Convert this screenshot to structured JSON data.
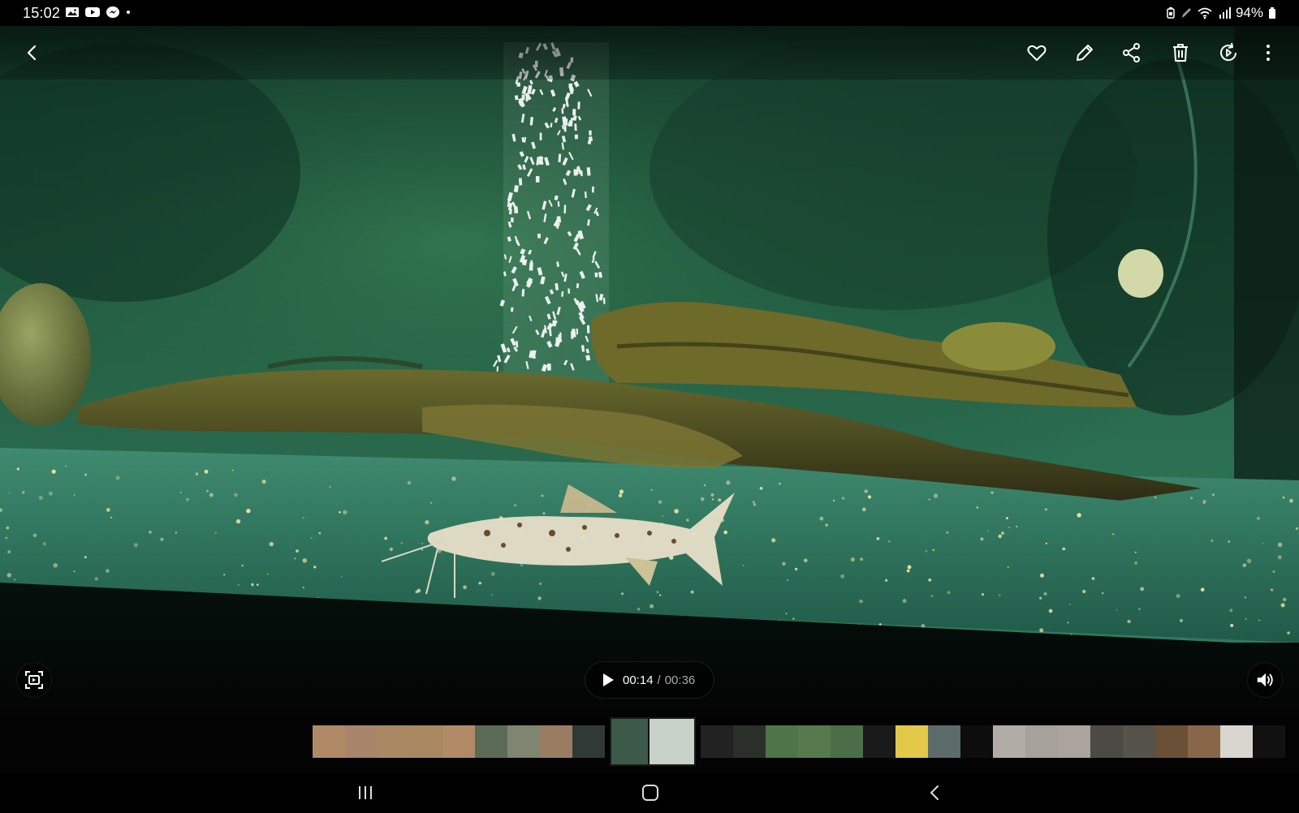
{
  "status_bar": {
    "time": "15:02",
    "left_icons": [
      "gallery-notification-icon",
      "youtube-notification-icon",
      "messenger-notification-icon",
      "more-notifications-dot-icon"
    ],
    "right_icons": [
      "battery-saver-icon",
      "pen-icon",
      "wifi-icon",
      "signal-icon"
    ],
    "battery_text": "94%"
  },
  "toolbar": {
    "back": "back-icon",
    "actions": [
      "favorite-heart-icon",
      "edit-pencil-icon",
      "share-icon",
      "delete-trash-icon",
      "rotate-video-icon",
      "more-options-icon"
    ]
  },
  "video": {
    "current_time": "00:14",
    "separator": "/",
    "total_time": "00:36",
    "state": "paused",
    "capture_icon": "capture-frame-icon",
    "volume_icon": "volume-icon"
  },
  "filmstrip": {
    "current_index": 9,
    "thumbs": [
      {
        "color": "#b08a66"
      },
      {
        "color": "#a8846a"
      },
      {
        "color": "#ab8864"
      },
      {
        "color": "#a9875f"
      },
      {
        "color": "#b18a68"
      },
      {
        "color": "#5b6b55"
      },
      {
        "color": "#7e8570"
      },
      {
        "color": "#9a7c62"
      },
      {
        "color": "#2f3a36"
      },
      {
        "color": "#3b5a4a"
      },
      {
        "color": "#c8d2c8"
      },
      {
        "color": "#222"
      },
      {
        "color": "#2b2f2a"
      },
      {
        "color": "#4f7449"
      },
      {
        "color": "#577a4c"
      },
      {
        "color": "#4b6e48"
      },
      {
        "color": "#1a1a1a"
      },
      {
        "color": "#e3c84a"
      },
      {
        "color": "#5d6a6a"
      },
      {
        "color": "#0d0d0d"
      },
      {
        "color": "#b2aca6"
      },
      {
        "color": "#a7a19b"
      },
      {
        "color": "#aaa39e"
      },
      {
        "color": "#4c4a44"
      },
      {
        "color": "#55524a"
      },
      {
        "color": "#6a5036"
      },
      {
        "color": "#8a6648"
      },
      {
        "color": "#d9d5cf"
      },
      {
        "color": "#111"
      },
      {
        "color": "#3a3a38"
      }
    ]
  },
  "nav_bar": {
    "recents": "recents-icon",
    "home": "home-icon",
    "back": "nav-back-icon"
  }
}
